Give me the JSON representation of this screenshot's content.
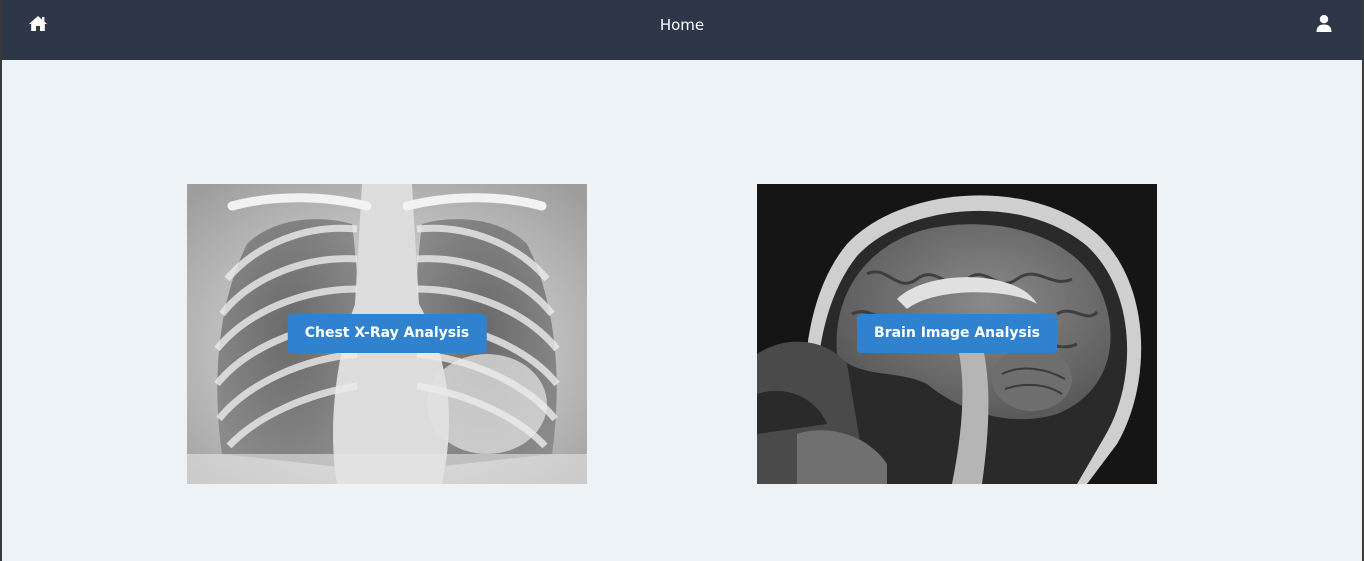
{
  "navbar": {
    "home_icon": "home-icon",
    "title": "Home",
    "user_icon": "user-icon"
  },
  "cards": [
    {
      "image": "chest-xray-image",
      "button_label": "Chest X-Ray Analysis"
    },
    {
      "image": "brain-mri-image",
      "button_label": "Brain Image Analysis"
    }
  ],
  "colors": {
    "navbar_bg": "#2d3748",
    "page_bg": "#edf2f7",
    "button_bg": "#3182ce",
    "button_text": "#ffffff"
  }
}
